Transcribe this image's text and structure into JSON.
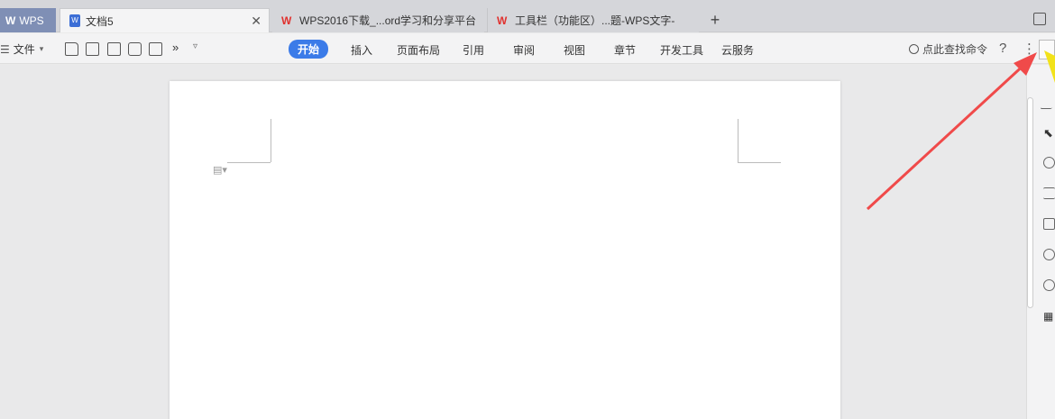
{
  "tabs": {
    "wps_label": "WPS",
    "doc_label": "文档5",
    "web1_label": "WPS2016下载_...ord学习和分享平台",
    "web2_label": "工具栏（功能区）...题-WPS文字-"
  },
  "toolbar": {
    "file_menu": "文件",
    "file_menu_icon": "hamburger-icon",
    "more_label": "»",
    "ribbon_tabs": [
      "开始",
      "插入",
      "页面布局",
      "引用",
      "审阅",
      "视图",
      "章节",
      "开发工具",
      "云服务"
    ],
    "search_placeholder": "点此查找命令",
    "help_label": "?",
    "more_options_label": "⋮"
  },
  "colors": {
    "active_tab": "#3b7be8",
    "arrow": "#f04a4a",
    "pointer": "#f2e21a"
  }
}
